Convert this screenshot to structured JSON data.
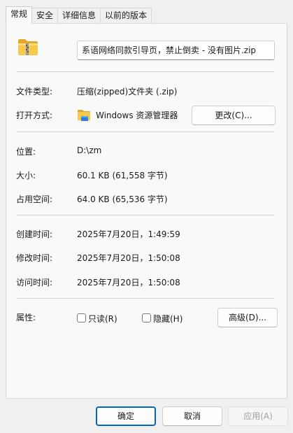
{
  "tabs": [
    "常规",
    "安全",
    "详细信息",
    "以前的版本"
  ],
  "file": {
    "name": "系语网络同款引导页，禁止倒卖 - 没有图片.zip",
    "type_label": "文件类型:",
    "type_value": "压缩(zipped)文件夹 (.zip)",
    "opens_with_label": "打开方式:",
    "opens_with_value": "Windows 资源管理器",
    "change_button": "更改(C)..."
  },
  "location": {
    "label": "位置:",
    "value": "D:\\zm"
  },
  "size": {
    "label": "大小:",
    "value": "60.1 KB (61,558 字节)"
  },
  "size_on_disk": {
    "label": "占用空间:",
    "value": "64.0 KB (65,536 字节)"
  },
  "times": {
    "created_label": "创建时间:",
    "created_value": "2025年7月20日，1:49:59",
    "modified_label": "修改时间:",
    "modified_value": "2025年7月20日，1:50:08",
    "accessed_label": "访问时间:",
    "accessed_value": "2025年7月20日，1:50:08"
  },
  "attributes": {
    "label": "属性:",
    "readonly": "只读(R)",
    "hidden": "隐藏(H)",
    "advanced_button": "高级(D)..."
  },
  "footer": {
    "ok": "确定",
    "cancel": "取消",
    "apply": "应用(A)"
  },
  "colors": {
    "accent": "#0067c0",
    "folder_yellow": "#f4c542"
  }
}
